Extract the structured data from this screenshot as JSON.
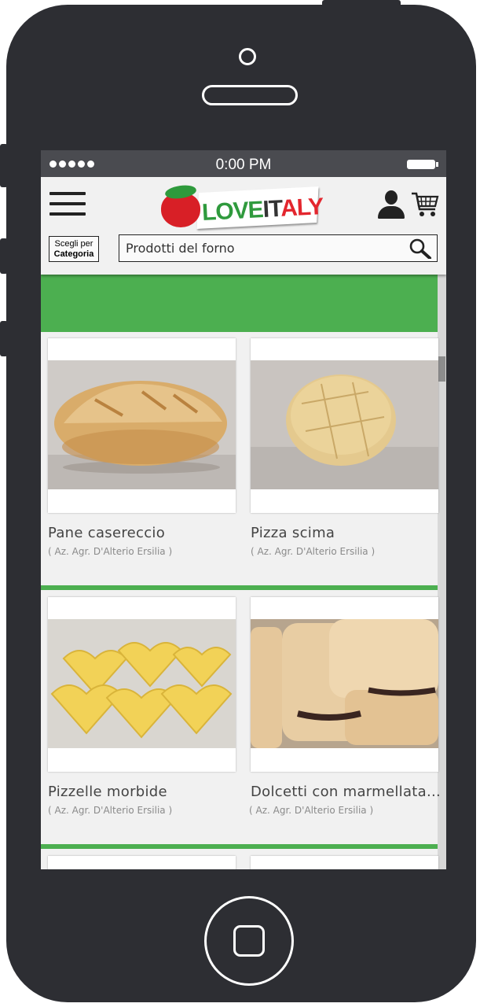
{
  "status_bar": {
    "time": "0:00 PM"
  },
  "header": {
    "logo": {
      "part1": "LOVE",
      "part2": "IT",
      "part3": "ALY"
    },
    "category_button": {
      "line1": "Scegli per",
      "line2": "Categoria"
    },
    "search": {
      "value": "Prodotti del forno"
    }
  },
  "products": [
    {
      "title": "Pane casereccio",
      "producer": "( Az. Agr. D'Alterio Ersilia )",
      "image": "bread-loaf"
    },
    {
      "title": "Pizza scima",
      "producer": "( Az. Agr. D'Alterio Ersilia )",
      "image": "round-flatbread"
    },
    {
      "title": "Pizzelle morbide",
      "producer": "( Az. Agr. D'Alterio Ersilia )",
      "image": "heart-waffles"
    },
    {
      "title": "Dolcetti con marmellata...",
      "producer": "( Az. Agr. D'Alterio Ersilia )",
      "image": "jam-pastries"
    }
  ],
  "colors": {
    "accent_green": "#4caf50",
    "logo_red": "#d81f26",
    "phone_body": "#2d2e33"
  }
}
